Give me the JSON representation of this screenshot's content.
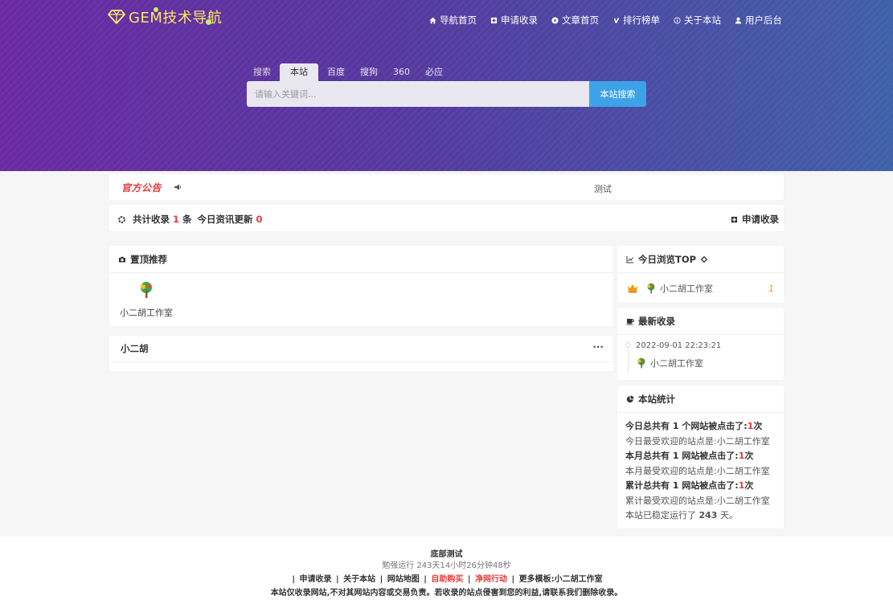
{
  "logo": {
    "text": "GEM技术导航"
  },
  "nav": [
    {
      "icon": "home-icon",
      "label": "导航首页"
    },
    {
      "icon": "plus-square-icon",
      "label": "申请收录"
    },
    {
      "icon": "compass-icon",
      "label": "文章首页"
    },
    {
      "icon": "vimeo-icon",
      "label": "排行榜单"
    },
    {
      "icon": "info-icon",
      "label": "关于本站"
    },
    {
      "icon": "user-icon",
      "label": "用户后台"
    }
  ],
  "search": {
    "label": "搜索",
    "tabs": [
      "本站",
      "百度",
      "搜狗",
      "360",
      "必应"
    ],
    "active": "本站",
    "placeholder": "请输入关键词...",
    "button": "本站搜索"
  },
  "notice": {
    "brand": "官方公告",
    "message": "测试"
  },
  "stats_bar": {
    "total_prefix": "共计收录",
    "total_count": "1",
    "total_unit": "条",
    "today_prefix": "今日资讯更新",
    "today_count": "0",
    "apply": "申请收录"
  },
  "pinned": {
    "title": "置顶推荐",
    "site_name": "小二胡工作室"
  },
  "category": {
    "title": "小二胡",
    "more": "···"
  },
  "top_views": {
    "title": "今日浏览TOP",
    "site_name": "小二胡工作室",
    "count": "1"
  },
  "latest": {
    "title": "最新收录",
    "time": "2022-09-01 22:23:21",
    "site_name": "小二胡工作室"
  },
  "site_stats": {
    "title": "本站统计",
    "today_clicks_pre": "今日总共有 1 个网站被点击了:",
    "today_clicks_num": "1",
    "today_clicks_unit": "次",
    "today_fav": "今日最受欢迎的站点是:",
    "today_fav_name": "小二胡工作室",
    "month_clicks_pre": "本月总共有 1 网站被点击了:",
    "month_clicks_num": "1",
    "month_clicks_unit": "次",
    "month_fav": "本月最受欢迎的站点是:",
    "month_fav_name": "小二胡工作室",
    "total_clicks_pre": "累计总共有 1 网站被点击了:",
    "total_clicks_num": "1",
    "total_clicks_unit": "次",
    "total_fav": "累计最受欢迎的站点是:",
    "total_fav_name": "小二胡工作室",
    "uptime_pre": "本站已稳定运行了",
    "uptime_days": "243",
    "uptime_unit": "天。"
  },
  "footer": {
    "title": "底部测试",
    "runtime": "勉强运行  243天14小时26分钟48秒",
    "links": [
      "申请收录",
      "关于本站",
      "网站地图",
      "自助购买",
      "净网行动"
    ],
    "more_templates": "更多模板:小二胡工作室",
    "disclaimer": "本站仅收录网站,不对其网站内容或交易负责。若收录的站点侵害到您的利益,请联系我们删除收录。"
  },
  "colors": {
    "accent": "#3da3e8",
    "red": "#e23a3a",
    "orange": "#f39c12",
    "gradient_start": "#6a2aa3",
    "gradient_end": "#4060a9"
  }
}
